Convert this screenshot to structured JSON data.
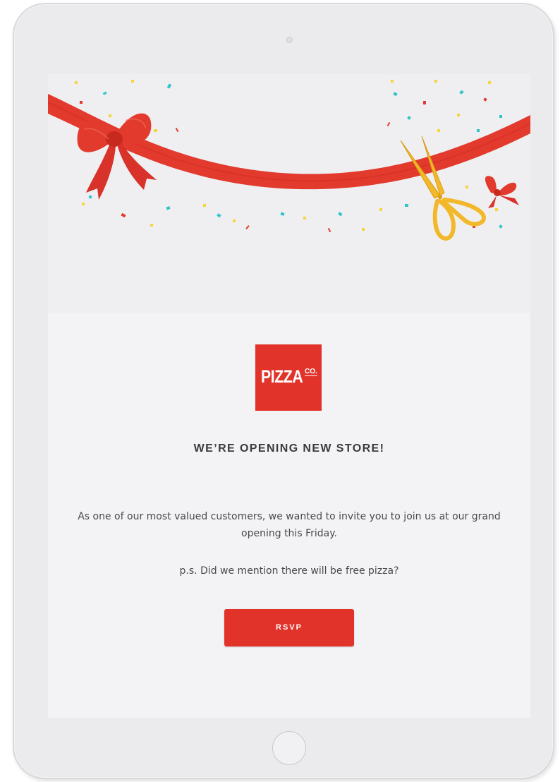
{
  "email": {
    "logo": {
      "text": "PIZZA",
      "suffix": "CO."
    },
    "headline": "WE’RE OPENING NEW STORE!",
    "body": "As one of our most valued customers, we wanted to invite you to join us at our grand opening this Friday.",
    "postscript": "p.s. Did we mention there will be free pizza?",
    "cta_label": "RSVP"
  },
  "device": {
    "type": "tablet",
    "home_button_icon": "home-button-circle",
    "camera_icon": "camera-dot"
  },
  "hero": {
    "illustration": "ribbon-cutting",
    "icons": [
      "ribbon-bow-icon",
      "scissors-icon",
      "confetti-icon"
    ]
  },
  "colors": {
    "brand_red": "#e1332a",
    "ribbon_red": "#e23a2d",
    "scissors_gold": "#f2b829",
    "confetti_teal": "#2ec4c9",
    "confetti_yellow": "#f5d53a",
    "background": "#f3f3f5",
    "text": "#4a4a4e"
  }
}
